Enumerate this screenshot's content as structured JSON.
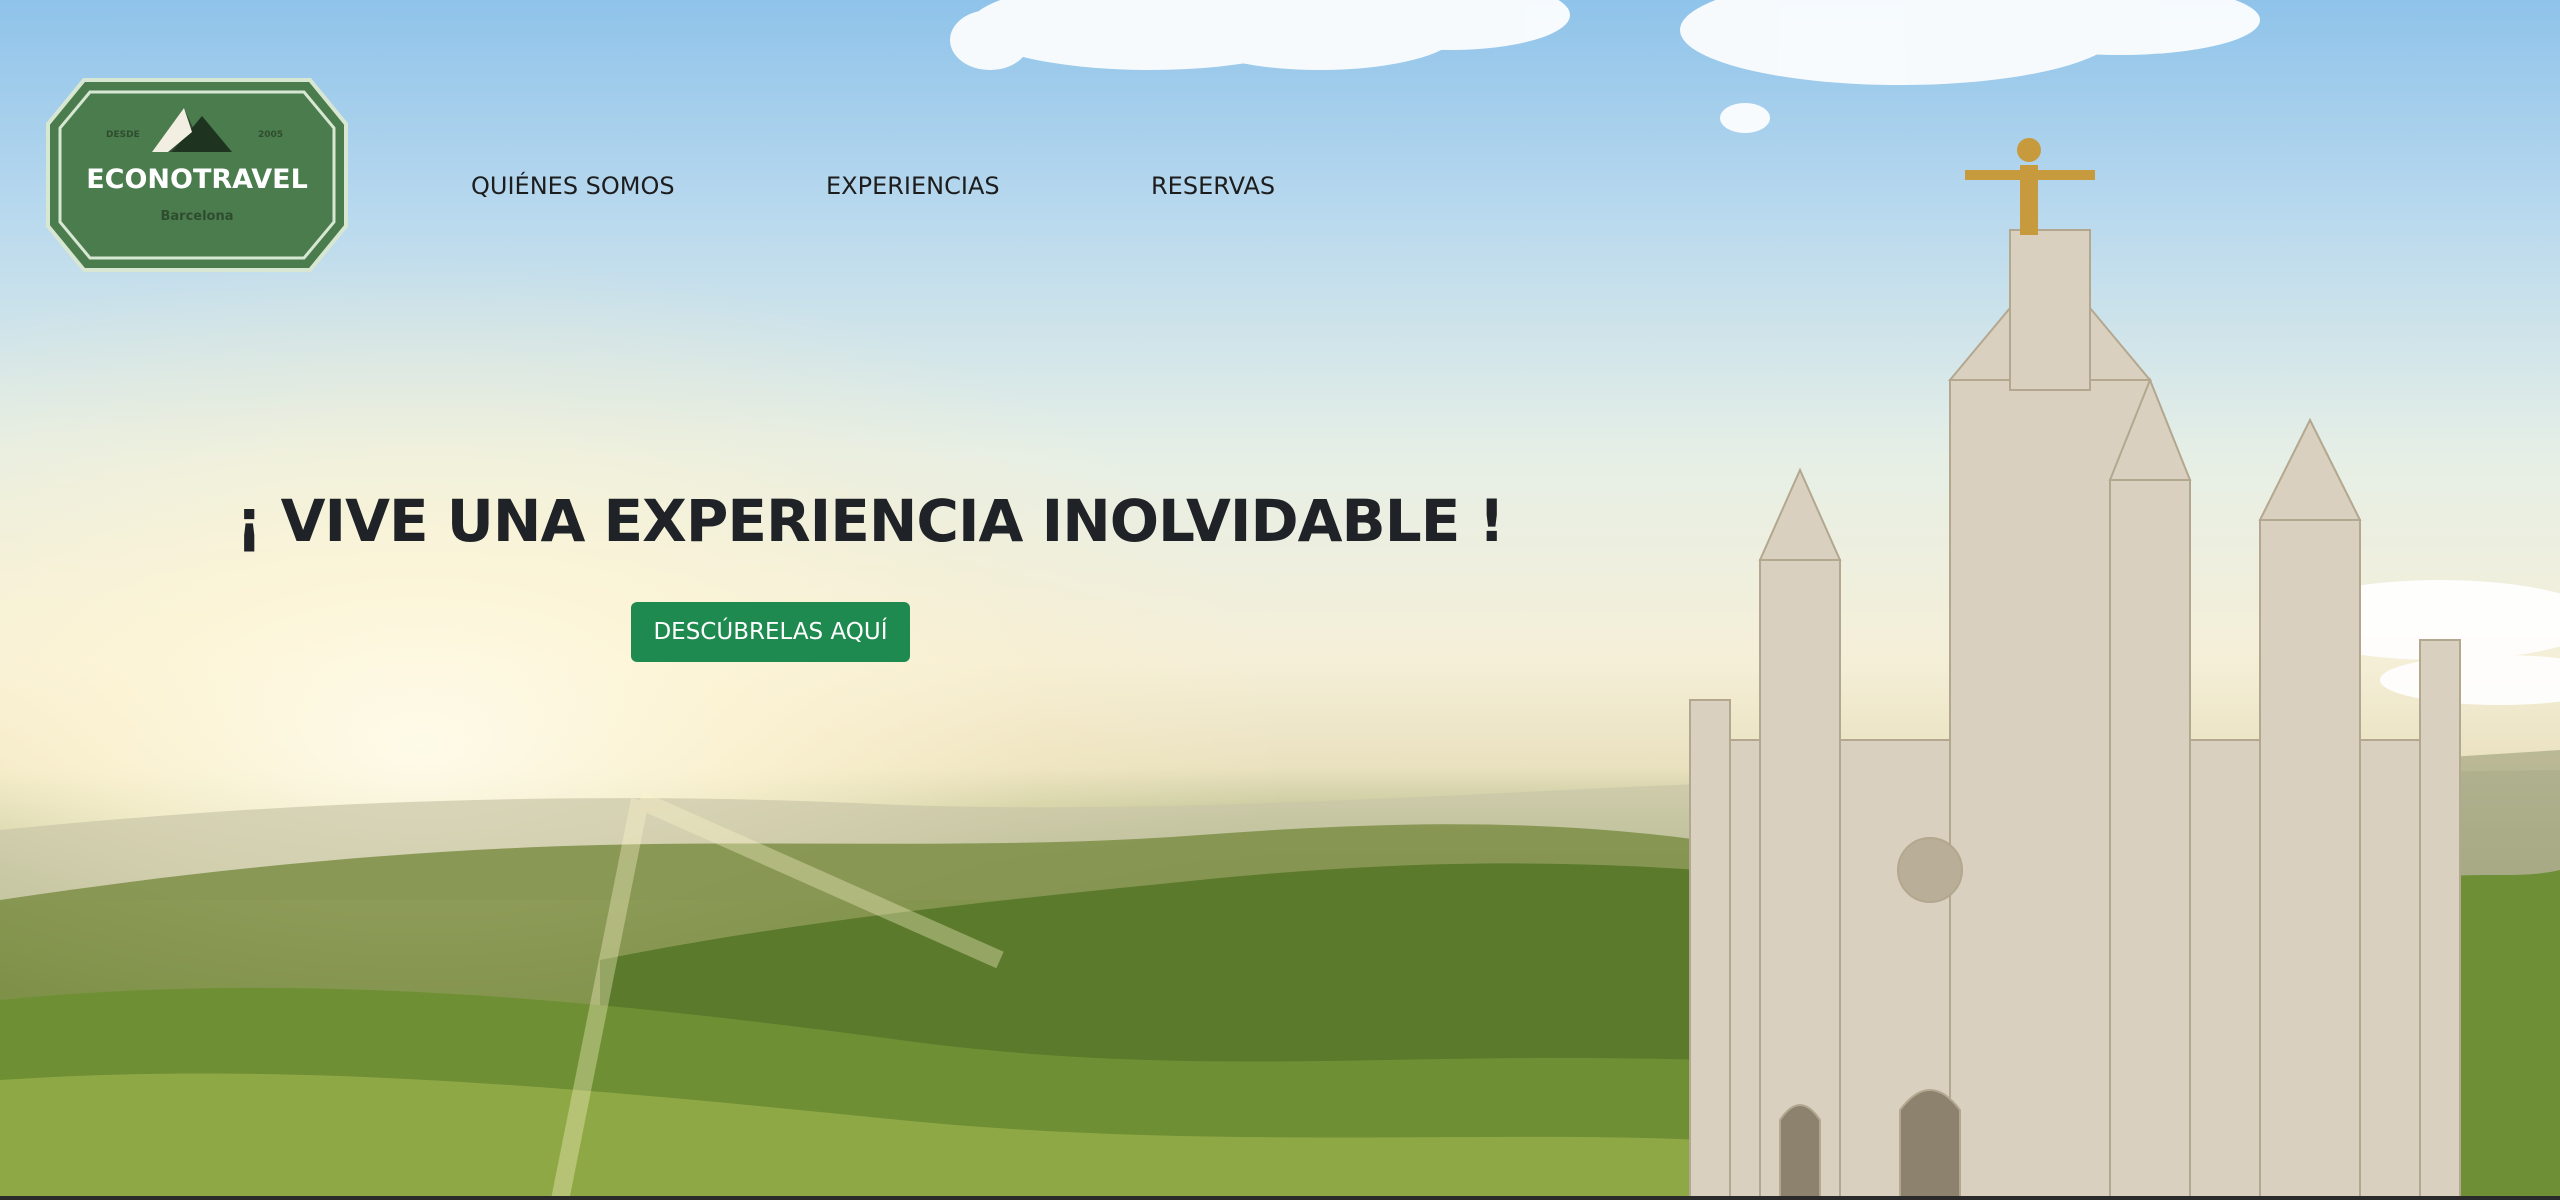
{
  "brand": {
    "name": "ECONOTRAVEL",
    "since_label": "DESDE",
    "since_year": "2005",
    "city": "Barcelona",
    "color": "#4a7c4e"
  },
  "nav": {
    "items": [
      {
        "label": "QUIÉNES SOMOS"
      },
      {
        "label": "EXPERIENCIAS"
      },
      {
        "label": "RESERVAS"
      }
    ]
  },
  "hero": {
    "headline": "¡ VIVE UNA EXPERIENCIA INOLVIDABLE !",
    "cta_label": "DESCÚBRELAS AQUÍ",
    "cta_color": "#1f8a4f",
    "background_image": "temple-of-sacred-heart-tibidabo-landscape"
  }
}
